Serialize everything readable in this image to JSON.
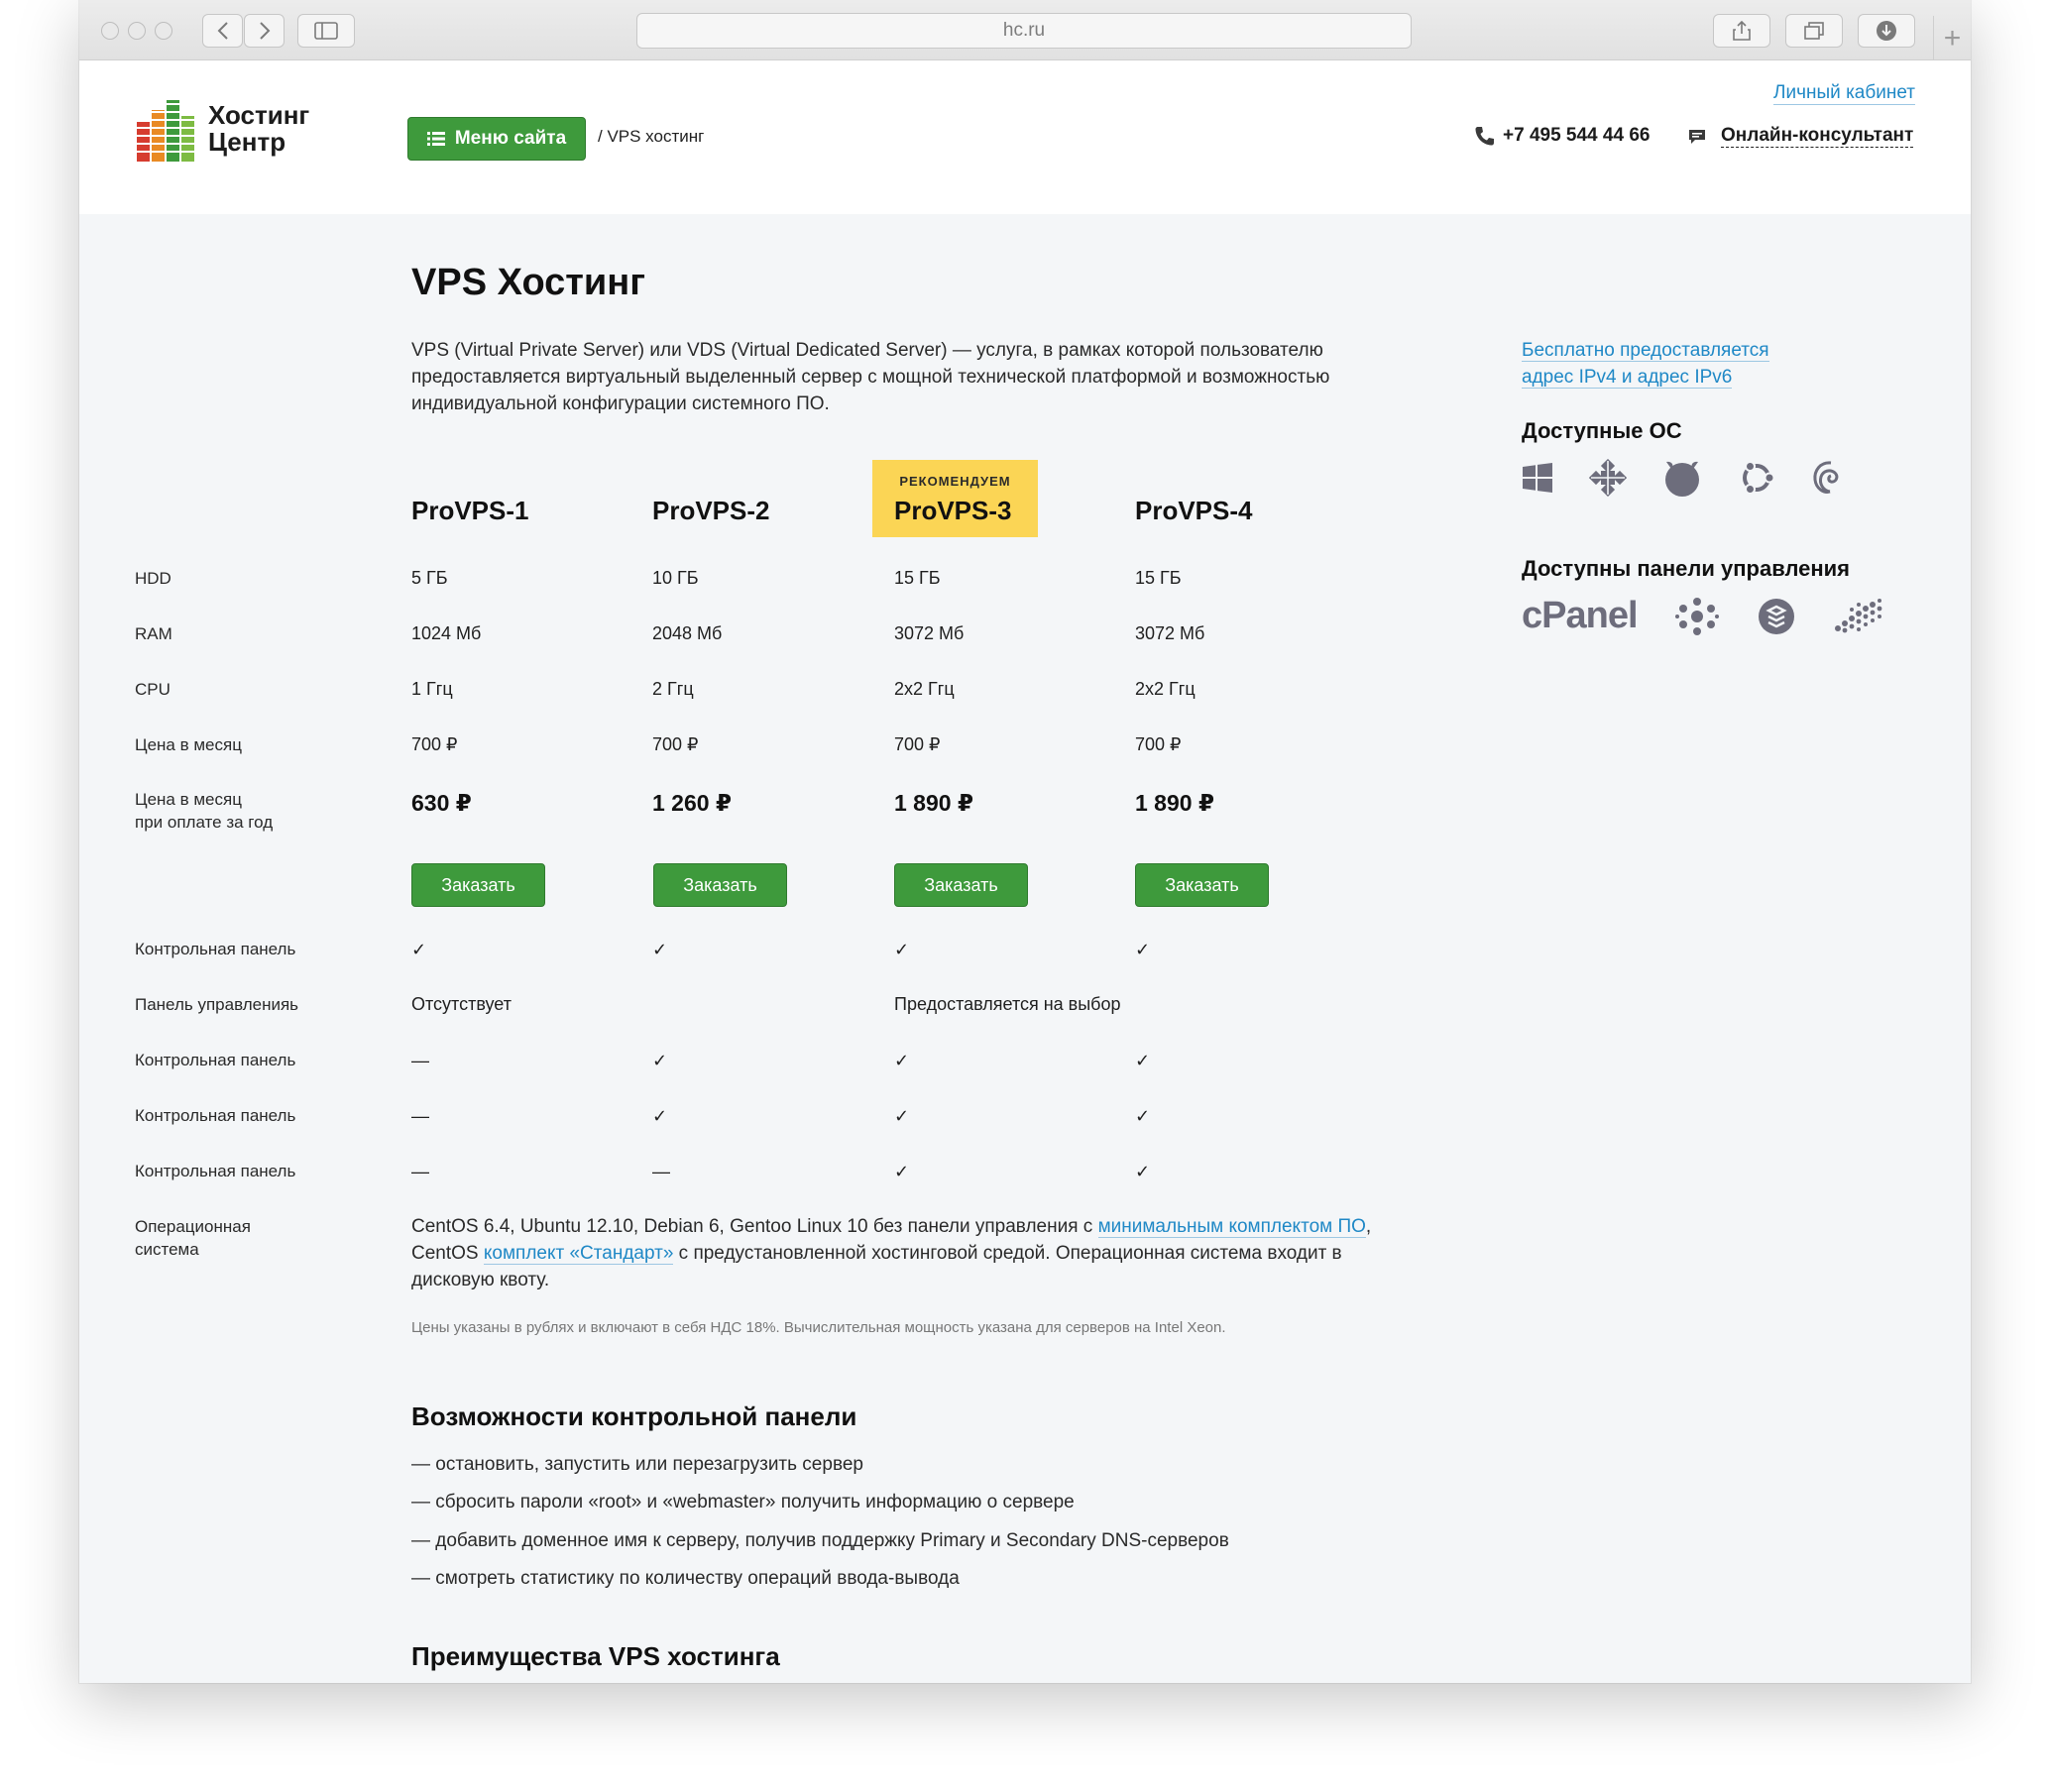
{
  "browser": {
    "url": "hc.ru",
    "new_tab": "+"
  },
  "header": {
    "logo_line1": "Хостинг",
    "logo_line2": "Центр",
    "menu_button": "Меню сайта",
    "breadcrumb": "/ VPS хостинг",
    "cabinet_link": "Личный кабинет",
    "phone": "+7 495 544 44 66",
    "consultant": "Онлайн-консультант"
  },
  "main": {
    "title": "VPS Хостинг",
    "intro": "VPS (Virtual Private Server) или VDS (Virtual Dedicated Server) — услуга, в рамках которой пользователю предоставляется виртуальный выделенный сервер с мощной технической платформой и возможностью индивидуальной конфигурации системного ПО."
  },
  "sidebar": {
    "ip_link_line1": "Бесплатно предоставляется",
    "ip_link_line2": "адрес IPv4 и адрес IPv6",
    "os_heading": "Доступные ОС",
    "os_icons": [
      "windows-icon",
      "centos-icon",
      "freebsd-icon",
      "ubuntu-icon",
      "debian-icon"
    ],
    "panels_heading": "Доступны панели управления",
    "panel_logo_text": "cPanel",
    "panel_icons": [
      "cpanel-logo",
      "ispmanager-icon",
      "plesk-icon",
      "vestacp-icon"
    ]
  },
  "plans": {
    "recommended_tag": "РЕКОМЕНДУЕМ",
    "names": [
      "ProVPS-1",
      "ProVPS-2",
      "ProVPS-3",
      "ProVPS-4"
    ],
    "order_label": "Заказать"
  },
  "table": {
    "labels": {
      "hdd": "HDD",
      "ram": "RAM",
      "cpu": "CPU",
      "price_month": "Цена в месяц",
      "price_year_line1": "Цена в месяц",
      "price_year_line2": "при оплате за год",
      "control_panel": "Контрольная панель",
      "management_panel": "Панель управленияь",
      "os_line1": "Операционная",
      "os_line2": "система"
    },
    "hdd": [
      "5 ГБ",
      "10 ГБ",
      "15 ГБ",
      "15 ГБ"
    ],
    "ram": [
      "1024 Мб",
      "2048 Мб",
      "3072 Мб",
      "3072 Мб"
    ],
    "cpu": [
      "1 Ггц",
      "2 Ггц",
      "2x2 Ггц",
      "2x2 Ггц"
    ],
    "price_month": [
      "700 ₽",
      "700 ₽",
      "700 ₽",
      "700 ₽"
    ],
    "price_year": [
      "630 ₽",
      "1 260 ₽",
      "1 890 ₽",
      "1 890 ₽"
    ],
    "control_panel_1": [
      "✓",
      "✓",
      "✓",
      "✓"
    ],
    "management_panel": {
      "first": "Отсутствует",
      "rest": "Предоставляется на выбор"
    },
    "control_panel_2": [
      "—",
      "✓",
      "✓",
      "✓"
    ],
    "control_panel_3": [
      "—",
      "✓",
      "✓",
      "✓"
    ],
    "control_panel_4": [
      "—",
      "—",
      "✓",
      "✓"
    ],
    "os_text_1": "CentOS 6.4, Ubuntu 12.10, Debian 6, Gentoo Linux 10 без панели управления с ",
    "os_link_1": "минимальным комплектом ПО",
    "os_text_2": ", CentOS ",
    "os_link_2": "комплект «Стандарт»",
    "os_text_3": " с предустановленной хостинговой средой. Операционная система входит в дисковую квоту.",
    "note": "Цены указаны в рублях и включают в себя НДС 18%. Вычислительная мощность указана для серверов на Intel Xeon."
  },
  "features": {
    "heading": "Возможности контрольной панели",
    "items": [
      "— остановить, запустить или перезагрузить сервер",
      "— сбросить пароли «root» и «webmaster» получить информацию о сервере",
      "— добавить доменное имя к серверу, получив поддержку Primary и Secondary DNS-серверов",
      "— смотреть статистику по количеству операций ввода-вывода"
    ]
  },
  "advantages": {
    "heading": "Преимущества VPS хостинга"
  },
  "colors": {
    "accent_green": "#3e9a3c",
    "link_blue": "#1f88c6",
    "recommend_yellow": "#fbd555"
  }
}
